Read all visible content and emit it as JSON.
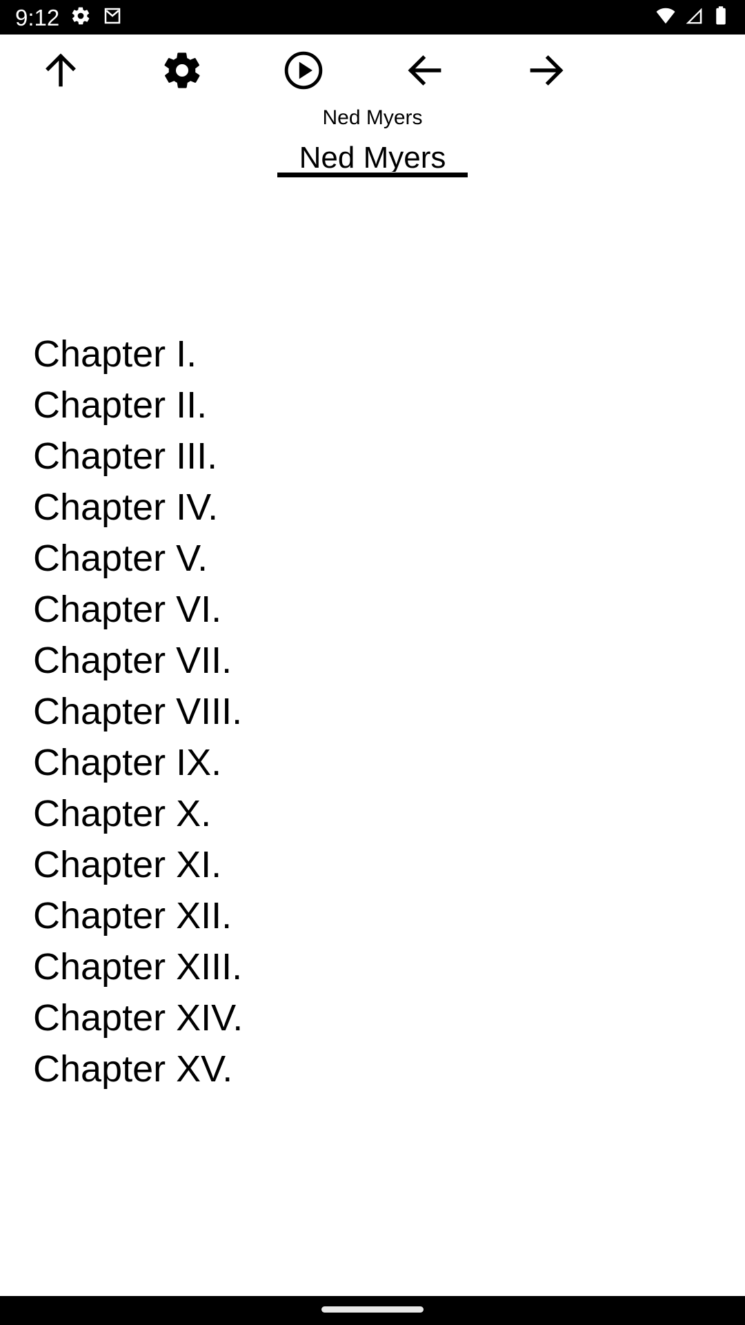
{
  "status_bar": {
    "clock": "9:12",
    "left_icons": [
      {
        "name": "settings-gear-icon"
      },
      {
        "name": "gmail-icon"
      }
    ],
    "right_icons": [
      {
        "name": "wifi-icon"
      },
      {
        "name": "cellular-signal-icon"
      },
      {
        "name": "battery-icon"
      }
    ],
    "background_color": "#000000",
    "foreground_color": "#ffffff"
  },
  "toolbar": {
    "buttons": [
      {
        "name": "scroll-up-button",
        "icon": "arrow-up-icon",
        "label": "Up"
      },
      {
        "name": "settings-button",
        "icon": "gear-icon",
        "label": "Settings"
      },
      {
        "name": "play-button",
        "icon": "play-circle-icon",
        "label": "Play"
      },
      {
        "name": "previous-button",
        "icon": "arrow-left-icon",
        "label": "Previous"
      },
      {
        "name": "next-button",
        "icon": "arrow-right-icon",
        "label": "Next"
      }
    ]
  },
  "header": {
    "subtitle": "Ned Myers",
    "title": "Ned Myers"
  },
  "toc": {
    "items": [
      {
        "label": "Chapter I."
      },
      {
        "label": "Chapter II."
      },
      {
        "label": "Chapter III."
      },
      {
        "label": "Chapter IV."
      },
      {
        "label": "Chapter V."
      },
      {
        "label": "Chapter VI."
      },
      {
        "label": "Chapter VII."
      },
      {
        "label": "Chapter VIII."
      },
      {
        "label": "Chapter IX."
      },
      {
        "label": "Chapter X."
      },
      {
        "label": "Chapter XI."
      },
      {
        "label": "Chapter XII."
      },
      {
        "label": "Chapter XIII."
      },
      {
        "label": "Chapter XIV."
      },
      {
        "label": "Chapter XV."
      }
    ]
  },
  "nav_bar": {
    "gesture_handle": "home-gesture-pill",
    "background_color": "#000000",
    "handle_color": "#e8e8e8"
  },
  "colors": {
    "page_background": "#ffffff",
    "text": "#000000",
    "system_bar": "#000000"
  }
}
